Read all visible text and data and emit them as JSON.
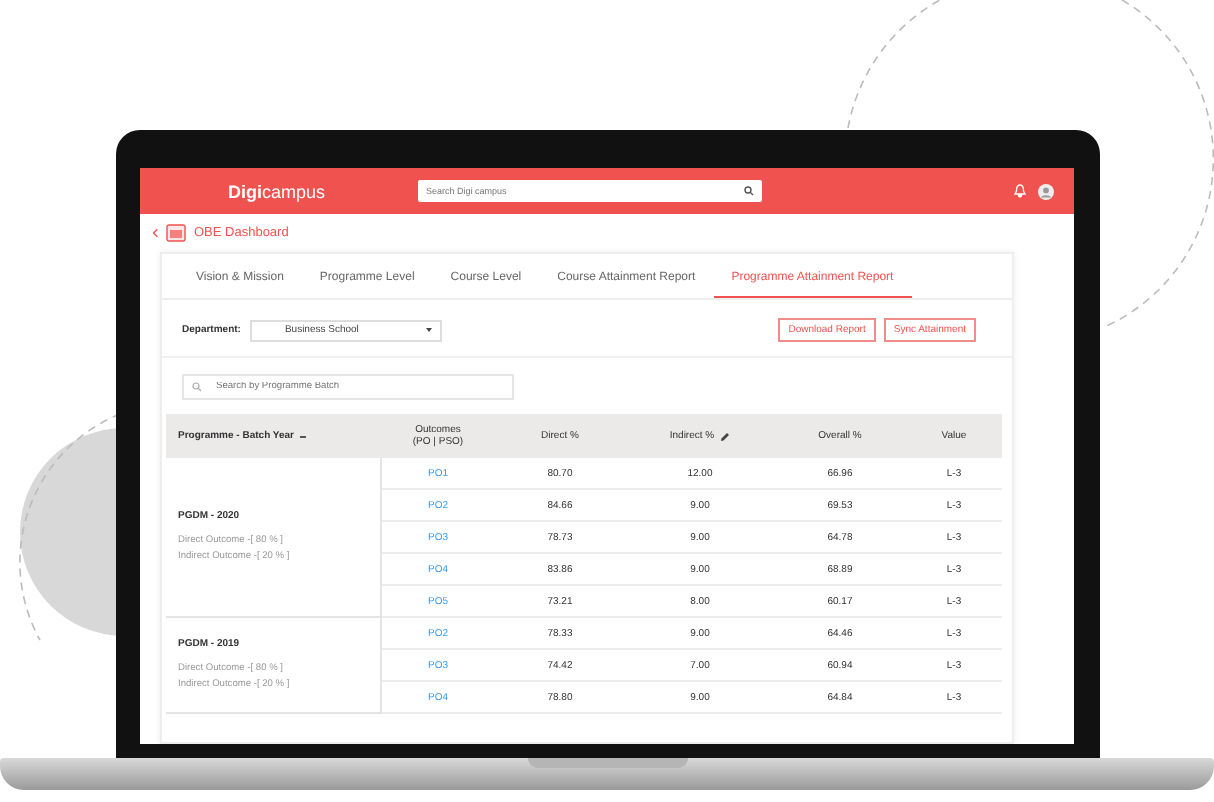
{
  "top_bar": {
    "logo": "**Digi**campus",
    "search": {
      "placeholder": "Search Digi campus"
    }
  },
  "breadcrumb": {
    "title": "OBE Dashboard"
  },
  "tabs": [
    {
      "label": "Vision & Mission",
      "selected": false
    },
    {
      "label": "Programme Level",
      "selected": false
    },
    {
      "label": "Course Level",
      "selected": false
    },
    {
      "label": "Course Attainment Report",
      "selected": false
    },
    {
      "label": "Programme Attainment Report",
      "selected": true
    }
  ],
  "department": {
    "label": "Department:",
    "value": "Business School"
  },
  "buttons": [
    "Download Report",
    "Sync Attainment"
  ],
  "batch_search": {
    "placeholder": "Search by Programme Batch"
  },
  "table": {
    "columns": [
      "Programme - Batch Year",
      "Outcomes\n(PO | PSO)",
      "Direct %",
      "Indirect %",
      "Overall %",
      "Value"
    ],
    "groups": [
      {
        "title": "PGDM - 2020",
        "direct": "Direct Outcome -[ 80 % ]",
        "indirect": "Indirect Outcome -[ 20 % ]",
        "rows": [
          {
            "outcome": "PO1",
            "direct": "80.70",
            "indirect": "12.00",
            "overall": "66.96",
            "value": "L-3"
          },
          {
            "outcome": "PO2",
            "direct": "84.66",
            "indirect": "9.00",
            "overall": "69.53",
            "value": "L-3"
          },
          {
            "outcome": "PO3",
            "direct": "78.73",
            "indirect": "9.00",
            "overall": "64.78",
            "value": "L-3"
          },
          {
            "outcome": "PO4",
            "direct": "83.86",
            "indirect": "9.00",
            "overall": "68.89",
            "value": "L-3"
          },
          {
            "outcome": "PO5",
            "direct": "73.21",
            "indirect": "8.00",
            "overall": "60.17",
            "value": "L-3"
          }
        ]
      },
      {
        "title": "PGDM - 2019",
        "direct": "Direct Outcome -[ 80 % ]",
        "indirect": "Indirect Outcome -[ 20 % ]",
        "rows": [
          {
            "outcome": "PO2",
            "direct": "78.33",
            "indirect": "9.00",
            "overall": "64.46",
            "value": "L-3"
          },
          {
            "outcome": "PO3",
            "direct": "74.42",
            "indirect": "7.00",
            "overall": "60.94",
            "value": "L-3"
          },
          {
            "outcome": "PO4",
            "direct": "78.80",
            "indirect": "9.00",
            "overall": "64.84",
            "value": "L-3"
          }
        ]
      }
    ]
  }
}
